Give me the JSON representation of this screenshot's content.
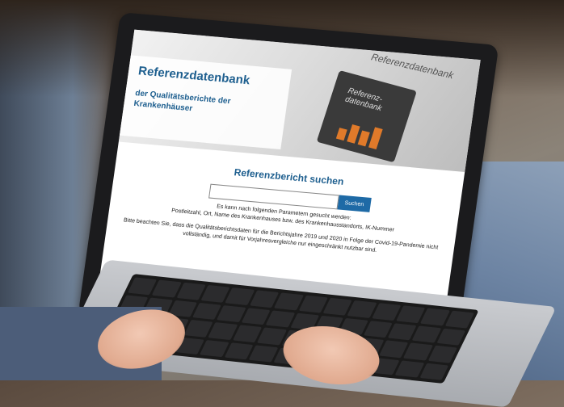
{
  "header": {
    "title": "Referenzdatenbank",
    "subtitle": "der Qualitätsberichte der Krankenhäuser",
    "decorative_title": "Referenzdatenbank",
    "book_label": "Referenz-datenbank"
  },
  "search": {
    "title": "Referenzbericht suchen",
    "input_value": "",
    "button_label": "Suchen",
    "hint_line1": "Es kann nach folgenden Parametern gesucht werden:",
    "hint_line2": "Postleitzahl, Ort, Name des Krankenhauses bzw. des Krankenhausstandorts, IK-Nummer"
  },
  "notice": {
    "text": "Bitte beachten Sie, dass die Qualitätsberichtsdaten für die Berichtsjahre 2019 und 2020 in Folge der Covid-19-Pandemie nicht vollständig, und damit für Vorjahresvergleiche nur eingeschränkt nutzbar sind."
  },
  "colors": {
    "brand_blue": "#1e5f8f",
    "button_blue": "#1e6aa6",
    "accent_orange": "#e07a2a"
  }
}
